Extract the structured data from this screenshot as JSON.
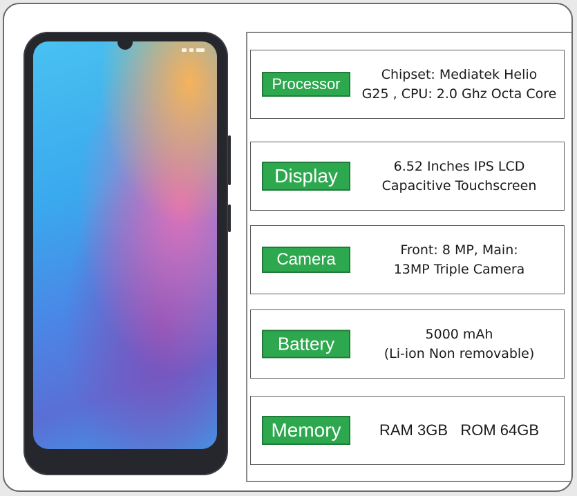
{
  "specs": [
    {
      "label": "Processor",
      "lines": [
        "Chipset: Mediatek Helio",
        "G25 , CPU: 2.0 Ghz Octa Core"
      ]
    },
    {
      "label": "Display",
      "lines": [
        "6.52 Inches IPS LCD",
        "Capacitive Touchscreen"
      ]
    },
    {
      "label": "Camera",
      "lines": [
        "Front: 8 MP, Main:",
        "13MP Triple Camera"
      ]
    },
    {
      "label": "Battery",
      "lines": [
        "5000 mAh",
        "(Li-ion Non removable)"
      ]
    },
    {
      "label": "Memory",
      "lines": [
        "RAM 3GB   ROM 64GB"
      ]
    }
  ],
  "colors": {
    "tag_green": "#2ea84f",
    "tag_border": "#1f7c38",
    "phone_body": "#26272c"
  },
  "icons": [
    "signal-icon",
    "wifi-icon",
    "battery-icon"
  ]
}
